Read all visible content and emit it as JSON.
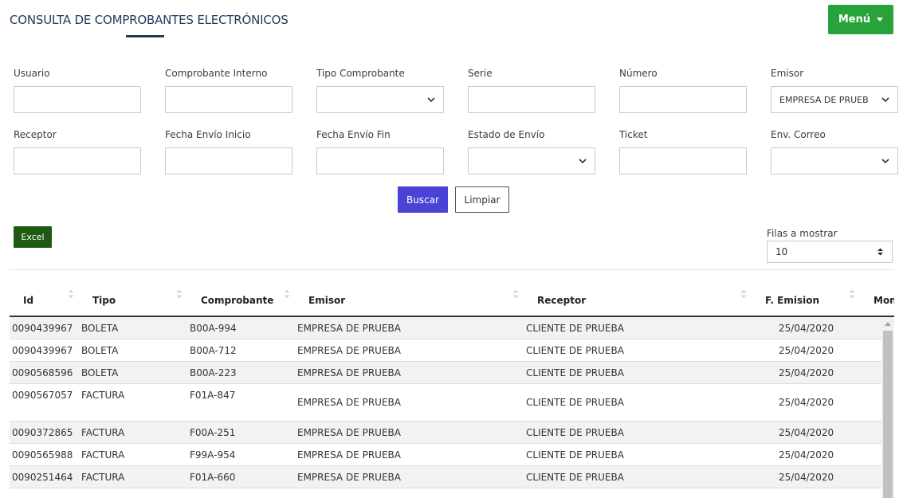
{
  "header": {
    "title": "CONSULTA DE COMPROBANTES ELECTRÓNICOS",
    "menu_label": "Menú",
    "colors": {
      "title": "#1f3a5a",
      "menu": "#28a23a"
    }
  },
  "filters": {
    "usuario": {
      "label": "Usuario",
      "value": ""
    },
    "comprobante_interno": {
      "label": "Comprobante Interno",
      "value": ""
    },
    "tipo_comprobante": {
      "label": "Tipo Comprobante",
      "value": ""
    },
    "serie": {
      "label": "Serie",
      "value": ""
    },
    "numero": {
      "label": "Número",
      "value": ""
    },
    "emisor": {
      "label": "Emisor",
      "value": "EMPRESA DE PRUEB"
    },
    "receptor": {
      "label": "Receptor",
      "value": ""
    },
    "fecha_envio_inicio": {
      "label": "Fecha Envío Inicio",
      "value": ""
    },
    "fecha_envio_fin": {
      "label": "Fecha Envío Fin",
      "value": ""
    },
    "estado_envio": {
      "label": "Estado de Envío",
      "value": ""
    },
    "ticket": {
      "label": "Ticket",
      "value": ""
    },
    "env_correo": {
      "label": "Env. Correo",
      "value": ""
    }
  },
  "actions": {
    "buscar": "Buscar",
    "limpiar": "Limpiar",
    "excel": "Excel",
    "colors": {
      "buscar": "#4a44d6",
      "excel": "#1e5a12"
    }
  },
  "rows_control": {
    "label": "Filas a mostrar",
    "value": "10"
  },
  "table": {
    "columns": [
      "Id",
      "Tipo",
      "Comprobante",
      "Emisor",
      "Receptor",
      "F. Emision",
      "Mon"
    ],
    "rows": [
      {
        "id": "0090439967",
        "tipo": "BOLETA",
        "comprobante": "B00A-994",
        "emisor": "EMPRESA DE PRUEBA",
        "receptor": "CLIENTE DE PRUEBA",
        "fecha": "25/04/2020"
      },
      {
        "id": "0090439967",
        "tipo": "BOLETA",
        "comprobante": "B00A-712",
        "emisor": "EMPRESA DE PRUEBA",
        "receptor": "CLIENTE DE PRUEBA",
        "fecha": "25/04/2020"
      },
      {
        "id": "0090568596",
        "tipo": "BOLETA",
        "comprobante": "B00A-223",
        "emisor": "EMPRESA DE PRUEBA",
        "receptor": "CLIENTE DE PRUEBA",
        "fecha": "25/04/2020"
      },
      {
        "id": "0090567057",
        "tipo": "FACTURA",
        "comprobante": "F01A-847",
        "emisor": "EMPRESA DE PRUEBA",
        "receptor": "CLIENTE DE PRUEBA",
        "fecha": "25/04/2020"
      },
      {
        "id": "0090372865",
        "tipo": "FACTURA",
        "comprobante": "F00A-251",
        "emisor": "EMPRESA DE PRUEBA",
        "receptor": "CLIENTE DE PRUEBA",
        "fecha": "25/04/2020"
      },
      {
        "id": "0090565988",
        "tipo": "FACTURA",
        "comprobante": "F99A-954",
        "emisor": "EMPRESA DE PRUEBA",
        "receptor": "CLIENTE DE PRUEBA",
        "fecha": "25/04/2020"
      },
      {
        "id": "0090251464",
        "tipo": "FACTURA",
        "comprobante": "F01A-660",
        "emisor": "EMPRESA DE PRUEBA",
        "receptor": "CLIENTE DE PRUEBA",
        "fecha": "25/04/2020"
      }
    ]
  }
}
